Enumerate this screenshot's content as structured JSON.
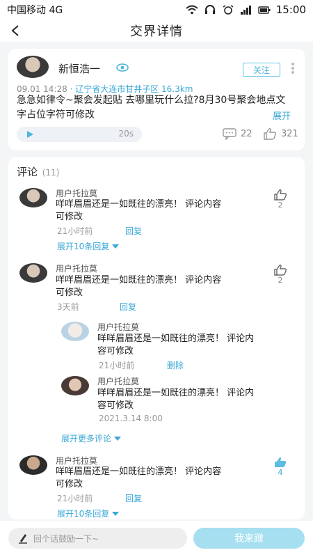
{
  "status_bar": {
    "carrier": "中国移动 4G",
    "time": "15:00"
  },
  "nav": {
    "title": "交界详情"
  },
  "post": {
    "author": "新恒浩一",
    "follow_label": "关注",
    "date_time": "09.01 14:28",
    "separator": "·",
    "location": "辽宁省大连市甘井子区 16.3km",
    "content": "急急如律令~聚会发起贴 去哪里玩什么拉?8月30号聚会地点文字占位字符可修改",
    "expand_label": "展开",
    "audio_duration": "20s",
    "comment_count": "22",
    "like_count": "321"
  },
  "comments": {
    "title": "评论",
    "count": "(11)",
    "items": [
      {
        "name": "用户托拉莫",
        "text_line1": "咩咩眉眉还是一如既往的漂亮！ 评论内容",
        "text_line2": "可修改",
        "time": "21小时前",
        "action": "回复",
        "likes": "2",
        "expand": "展开10条回复"
      },
      {
        "name": "用户托拉莫",
        "text_line1": "咩咩眉眉还是一如既往的漂亮！ 评论内容",
        "text_line2": "可修改",
        "time": "3天前",
        "action": "回复",
        "likes": "2",
        "replies": [
          {
            "name": "用户托拉莫",
            "text_line1": "咩咩眉眉还是一如既往的漂亮！ 评论内",
            "text_line2": "容可修改",
            "time": "21小时前",
            "action": "删除"
          },
          {
            "name": "用户托拉莫",
            "text_line1": "咩咩眉眉还是一如既往的漂亮！ 评论内",
            "text_line2": "容可修改",
            "time": "2021.3.14   8:00"
          }
        ],
        "more": "展开更多评论"
      },
      {
        "name": "用户托拉莫",
        "text_line1": "咩咩眉眉还是一如既往的漂亮！ 评论内容",
        "text_line2": "可修改",
        "time": "21小时前",
        "action": "回复",
        "likes": "4",
        "expand": "展开10条回复"
      }
    ]
  },
  "reply_bar": {
    "placeholder": "回个话鼓励一下~",
    "submit_label": "我来蹭"
  },
  "colors": {
    "accent": "#3aa8d6",
    "submit_bg": "#a6dff0"
  }
}
